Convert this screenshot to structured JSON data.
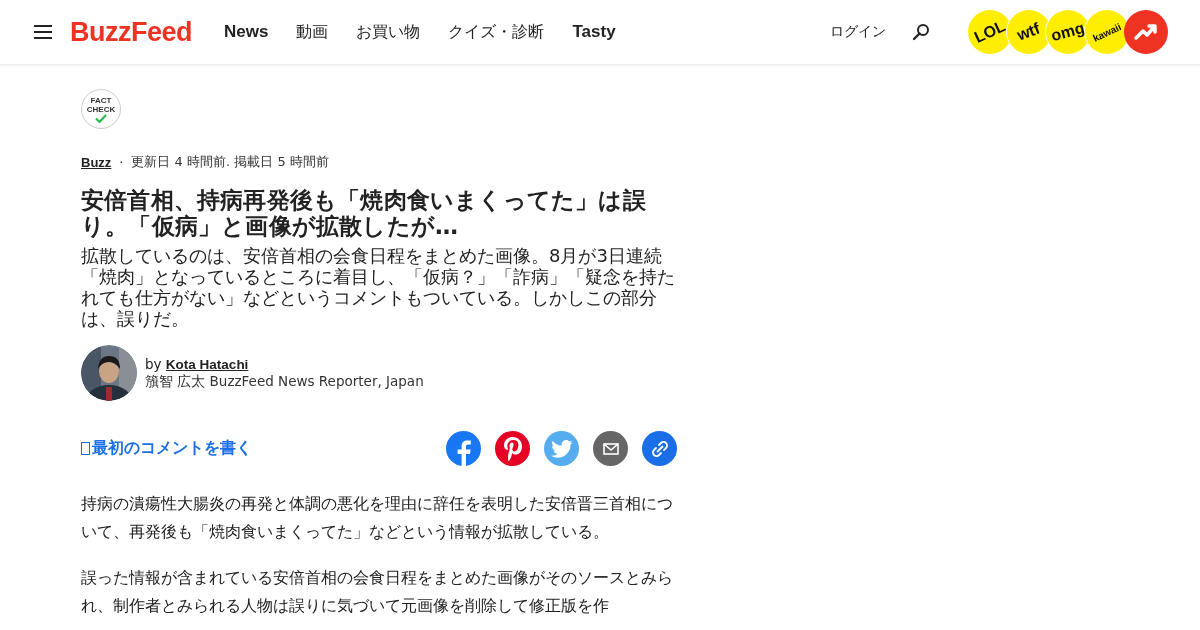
{
  "header": {
    "logo": "BuzzFeed",
    "nav": [
      {
        "label": "News",
        "bold": true
      },
      {
        "label": "動画",
        "bold": false
      },
      {
        "label": "お買い物",
        "bold": false
      },
      {
        "label": "クイズ・診断",
        "bold": false
      },
      {
        "label": "Tasty",
        "bold": true
      }
    ],
    "login": "ログイン",
    "badges": [
      {
        "kind": "text",
        "label": "LOL"
      },
      {
        "kind": "text",
        "label": "wtf"
      },
      {
        "kind": "text",
        "label": "omg"
      },
      {
        "kind": "text",
        "label": "kawaii"
      },
      {
        "kind": "trending"
      }
    ]
  },
  "article": {
    "fact_check": [
      "FACT",
      "CHECK"
    ],
    "category": "Buzz",
    "separator": "·",
    "dates": "更新日 4 時間前. 掲載日 5 時間前",
    "title": "安倍首相、持病再発後も「焼肉食いまくってた」は誤り。「仮病」と画像が拡散したが…",
    "description": "拡散しているのは、安倍首相の会食日程をまとめた画像。8月が3日連続「焼肉」となっているところに着目し、「仮病？」「詐病」「疑念を持たれても仕方がない」などというコメントもついている。しかしこの部分は、誤りだ。",
    "byline": {
      "by": "by",
      "author": "Kota Hatachi",
      "role": "籏智 広太 BuzzFeed News Reporter, Japan"
    },
    "comment_link": "最初のコメントを書く",
    "share": [
      {
        "kind": "facebook"
      },
      {
        "kind": "pinterest"
      },
      {
        "kind": "twitter"
      },
      {
        "kind": "email"
      },
      {
        "kind": "link"
      }
    ],
    "paragraphs": [
      "持病の潰瘍性大腸炎の再発と体調の悪化を理由に辞任を表明した安倍晋三首相について、再発後も「焼肉食いまくってた」などという情報が拡散している。",
      "誤った情報が含まれている安倍首相の会食日程をまとめた画像がそのソースとみられ、制作者とみられる人物は誤りに気づいて元画像を削除して修正版を作"
    ]
  }
}
